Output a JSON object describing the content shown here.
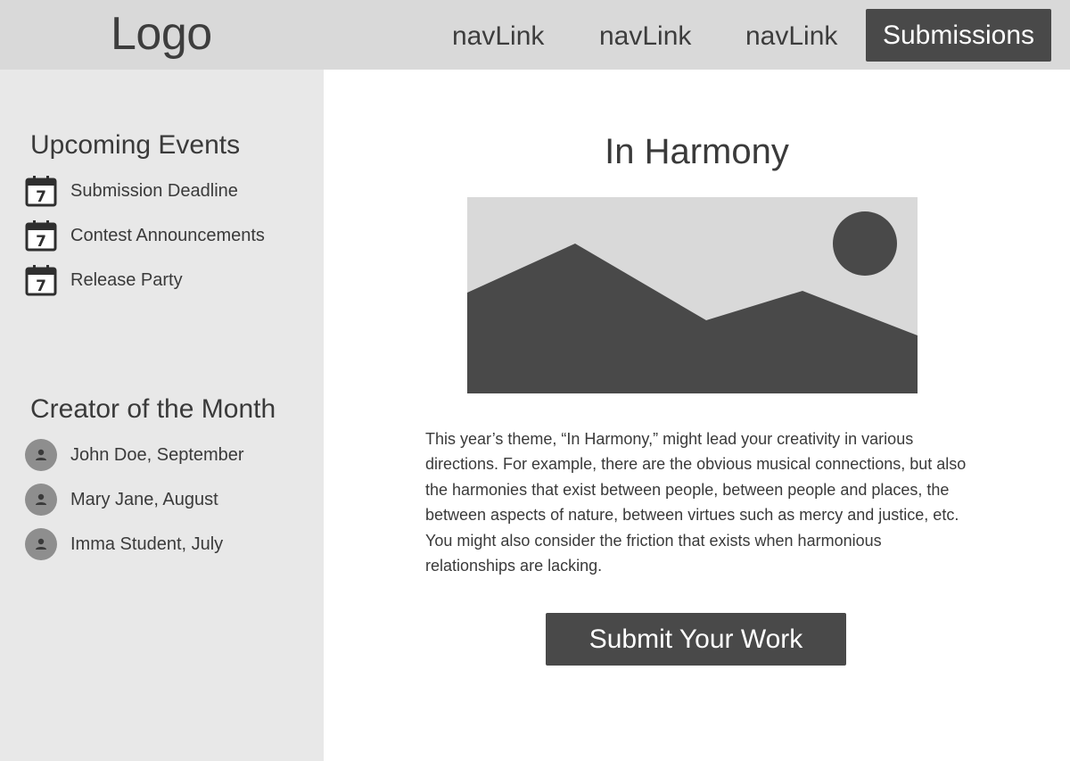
{
  "header": {
    "logo": "Logo",
    "nav_links": [
      "navLink",
      "navLink",
      "navLink"
    ],
    "submissions_label": "Submissions"
  },
  "sidebar": {
    "events_title": "Upcoming Events",
    "events": [
      {
        "label": "Submission Deadline",
        "icon": "calendar-icon",
        "day": "7"
      },
      {
        "label": "Contest Announcements",
        "icon": "calendar-icon",
        "day": "7"
      },
      {
        "label": "Release Party",
        "icon": "calendar-icon",
        "day": "7"
      }
    ],
    "creators_title": "Creator of the Month",
    "creators": [
      {
        "label": "John Doe, September",
        "icon": "user-icon"
      },
      {
        "label": "Mary Jane, August",
        "icon": "user-icon"
      },
      {
        "label": "Imma Student, July",
        "icon": "user-icon"
      }
    ]
  },
  "main": {
    "title": "In Harmony",
    "image_icon": "image-placeholder-icon",
    "body": "This year’s theme, “In Harmony,” might lead your creativity in various directions. For example, there are the obvious musical connections, but also the harmonies that exist between people, between people and places, the between aspects of nature, between virtues such as mercy and justice, etc. You might also consider the friction that exists when harmonious relationships are lacking.",
    "cta_label": "Submit Your Work"
  },
  "colors": {
    "header_bg": "#d9d9d9",
    "sidebar_bg": "#e8e8e8",
    "button_bg": "#494949",
    "text": "#3a3a3a"
  }
}
